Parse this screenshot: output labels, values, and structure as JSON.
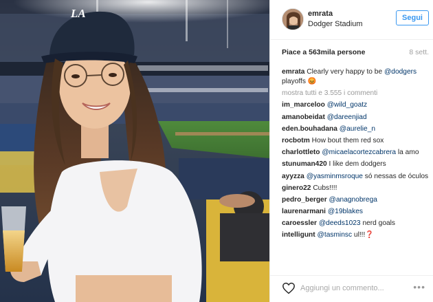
{
  "header": {
    "username": "emrata",
    "location": "Dodger Stadium",
    "follow_label": "Segui"
  },
  "stats": {
    "likes": "Piace a 563mila persone",
    "time_ago": "8 sett."
  },
  "caption": {
    "user": "emrata",
    "text": "Clearly very happy to be",
    "mention": "@dodgers",
    "text2": "playoffs",
    "emoji": "😡"
  },
  "show_all": "mostra tutti e 3.555 i commenti",
  "comments": [
    {
      "user": "im_marceloo",
      "mention": "@wild_goatz",
      "text": ""
    },
    {
      "user": "amanobeidat",
      "mention": "@dareenjiad",
      "text": ""
    },
    {
      "user": "eden.bouhadana",
      "mention": "@aurelie_n",
      "text": ""
    },
    {
      "user": "rocbotm",
      "mention": "",
      "text": "How bout them red sox"
    },
    {
      "user": "charlottleto",
      "mention": "@micaelacortezcabrera",
      "text": "la amo"
    },
    {
      "user": "stunuman420",
      "mention": "",
      "text": "I like dem dodgers"
    },
    {
      "user": "ayyzza",
      "mention": "@yasminmsroque",
      "text": "só nessas de óculos"
    },
    {
      "user": "ginero22",
      "mention": "",
      "text": "Cubs!!!!"
    },
    {
      "user": "pedro_berger",
      "mention": "@anagnobrega",
      "text": ""
    },
    {
      "user": "laurenarmani",
      "mention": "@19blakes",
      "text": ""
    },
    {
      "user": "caroessler",
      "mention": "@deeds1023",
      "text": "nerd goals"
    },
    {
      "user": "intelligunt",
      "mention": "@tasminsc",
      "text": "ul!!!❓"
    }
  ],
  "footer": {
    "add_comment_placeholder": "Aggiungi un commento...",
    "more_label": "•••"
  },
  "photo": {
    "cap_logo": "LA"
  },
  "colors": {
    "accent": "#3897f0",
    "mention": "#003569",
    "muted": "#999999"
  },
  "icons": {
    "like": "heart-outline-icon",
    "more": "ellipsis-icon"
  }
}
